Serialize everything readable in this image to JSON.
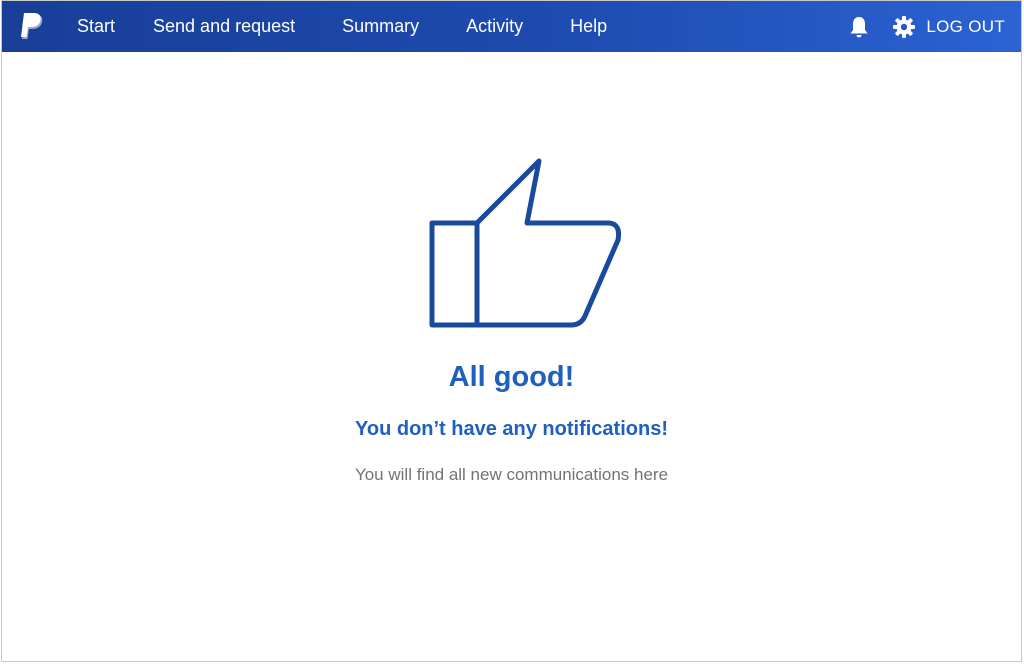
{
  "nav": {
    "logo_icon": "paypal-logo-icon",
    "links": [
      {
        "label": "Start"
      },
      {
        "label": "Send and request"
      },
      {
        "label": "Summary"
      },
      {
        "label": "Activity"
      },
      {
        "label": "Help"
      }
    ],
    "notifications_icon": "bell-icon",
    "settings_icon": "gear-icon",
    "logout_label": "LOG OUT"
  },
  "main": {
    "illustration_icon": "thumbs-up-icon",
    "headline": "All good!",
    "subheadline": "You don’t have any notifications!",
    "description": "You will find all new communications here"
  },
  "colors": {
    "nav_gradient_start": "#183e97",
    "nav_gradient_end": "#2b63d3",
    "accent": "#1f5fbf",
    "icon_stroke": "#1a4a9c",
    "muted_text": "#737373"
  }
}
